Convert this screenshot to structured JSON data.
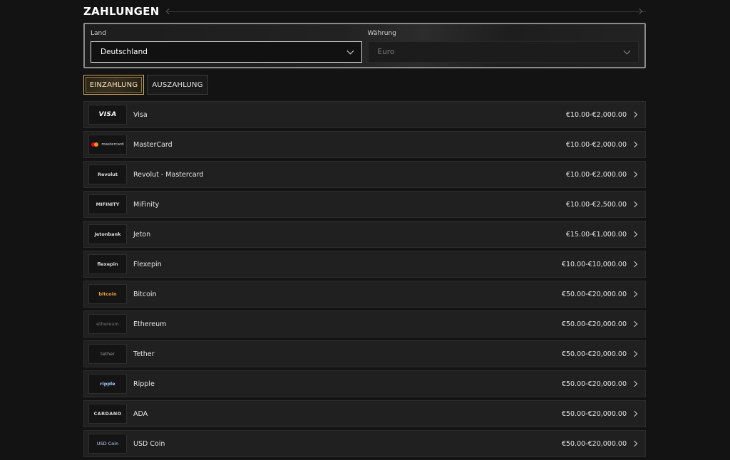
{
  "header": {
    "title": "ZAHLUNGEN"
  },
  "filters": {
    "country": {
      "label": "Land",
      "value": "Deutschland"
    },
    "currency": {
      "label": "Währung",
      "value": "Euro"
    }
  },
  "tabs": [
    {
      "label": "EINZAHLUNG",
      "active": true
    },
    {
      "label": "AUSZAHLUNG",
      "active": false
    }
  ],
  "methods": [
    {
      "name": "Visa",
      "range": "€10.00-€2,000.00",
      "logo_text": "VISA",
      "icon": "visa-logo"
    },
    {
      "name": "MasterCard",
      "range": "€10.00-€2,000.00",
      "logo_text": "mastercard",
      "icon": "mastercard-logo"
    },
    {
      "name": "Revolut - Mastercard",
      "range": "€10.00-€2,000.00",
      "logo_text": "Revolut",
      "icon": "revolut-logo"
    },
    {
      "name": "MiFinity",
      "range": "€10.00-€2,500.00",
      "logo_text": "MIFINITY",
      "icon": "mifinity-logo"
    },
    {
      "name": "Jeton",
      "range": "€15.00-€1,000.00",
      "logo_text": "Jetonbank",
      "icon": "jeton-logo"
    },
    {
      "name": "Flexepin",
      "range": "€10.00-€10,000.00",
      "logo_text": "flexepin",
      "icon": "flexepin-logo"
    },
    {
      "name": "Bitcoin",
      "range": "€50.00-€20,000.00",
      "logo_text": "bitcoin",
      "icon": "bitcoin-logo"
    },
    {
      "name": "Ethereum",
      "range": "€50.00-€20,000.00",
      "logo_text": "ethereum",
      "icon": "ethereum-logo"
    },
    {
      "name": "Tether",
      "range": "€50.00-€20,000.00",
      "logo_text": "tether",
      "icon": "tether-logo"
    },
    {
      "name": "Ripple",
      "range": "€50.00-€20,000.00",
      "logo_text": "ripple",
      "icon": "ripple-logo"
    },
    {
      "name": "ADA",
      "range": "€50.00-€20,000.00",
      "logo_text": "CARDANO",
      "icon": "cardano-logo"
    },
    {
      "name": "USD Coin",
      "range": "€50.00-€20,000.00",
      "logo_text": "USD Coin",
      "icon": "usdcoin-logo"
    }
  ],
  "colors": {
    "background": "#131313",
    "row": "#202020",
    "accent_gold": "#c8a86a",
    "mastercard_red": "#eb001b",
    "mastercard_orange": "#f79e1b",
    "bitcoin_orange": "#f2a23a"
  }
}
